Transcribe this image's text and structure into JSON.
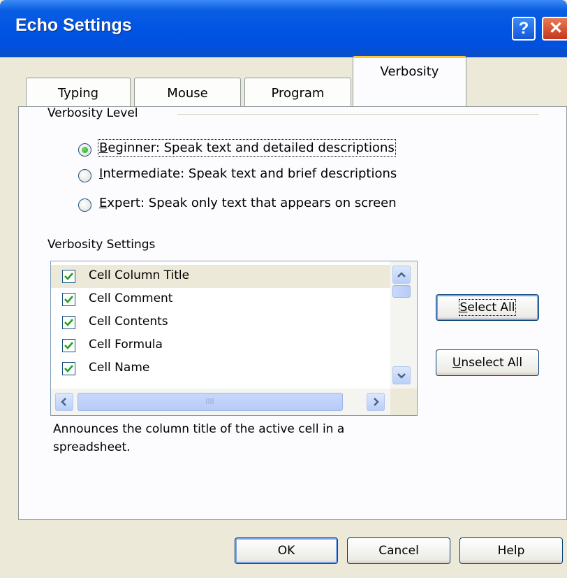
{
  "window": {
    "title": "Echo Settings"
  },
  "title_buttons": {
    "help": "?",
    "close": "✕"
  },
  "tabs": [
    {
      "label": "Typing"
    },
    {
      "label": "Mouse"
    },
    {
      "label": "Program"
    },
    {
      "label": "Verbosity",
      "active": true
    }
  ],
  "verbosity_level": {
    "heading": "Verbosity Level",
    "options": [
      {
        "key": "B",
        "rest": "eginner: Speak text and detailed descriptions",
        "checked": true
      },
      {
        "key": "I",
        "rest": "ntermediate: Speak text and brief descriptions",
        "checked": false
      },
      {
        "key": "E",
        "rest": "xpert: Speak only text that appears on screen",
        "checked": false
      }
    ]
  },
  "verbosity_settings": {
    "heading": "Verbosity Settings",
    "items": [
      {
        "label": "Cell Column Title",
        "checked": true,
        "selected": true
      },
      {
        "label": "Cell Comment",
        "checked": true
      },
      {
        "label": "Cell Contents",
        "checked": true
      },
      {
        "label": "Cell Formula",
        "checked": true
      },
      {
        "label": "Cell Name",
        "checked": true
      }
    ],
    "description_line1": "Announces the column title of the active cell in a",
    "description_line2": "spreadsheet."
  },
  "buttons": {
    "select_all_key": "S",
    "select_all_rest": "elect All",
    "unselect_all_key": "U",
    "unselect_all_rest": "nselect All",
    "ok": "OK",
    "cancel": "Cancel",
    "help": "Help"
  },
  "colors": {
    "titlebar": "#0154e3",
    "dialog_bg": "#ece9d8",
    "active_tab_accent": "#ffc83c",
    "checkmark": "#21a121"
  }
}
